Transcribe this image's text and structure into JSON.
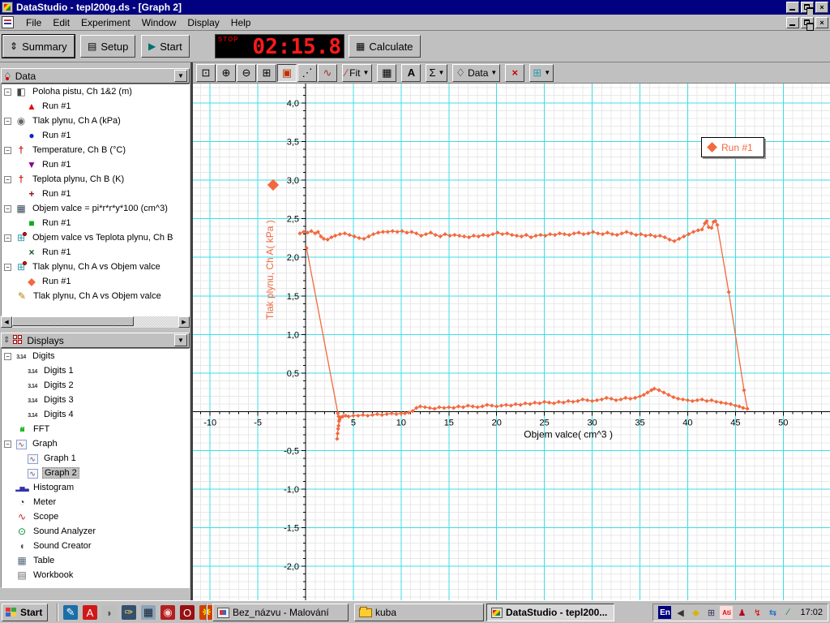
{
  "window": {
    "title": "DataStudio - tepl200g.ds - [Graph 2]"
  },
  "menu": {
    "items": [
      "File",
      "Edit",
      "Experiment",
      "Window",
      "Display",
      "Help"
    ]
  },
  "toolbar": {
    "summary_label": "Summary",
    "setup_label": "Setup",
    "start_label": "Start",
    "timer_stop_label": "STOP",
    "timer_value": "02:15.8",
    "calculate_label": "Calculate"
  },
  "graph_toolbar": {
    "buttons": [
      {
        "name": "scale-to-fit-button",
        "glyph": "⊡"
      },
      {
        "name": "zoom-in-button",
        "glyph": "⊕"
      },
      {
        "name": "zoom-out-button",
        "glyph": "⊖"
      },
      {
        "name": "zoom-select-button",
        "glyph": "⊞"
      },
      {
        "name": "smart-tool-button",
        "glyph": "▣",
        "pressed": true,
        "color": "#c03000"
      },
      {
        "name": "slope-tool-button",
        "glyph": "⋰"
      },
      {
        "name": "curve-note-button",
        "glyph": "∿",
        "color": "#a03030"
      },
      {
        "name": "fit-dropdown",
        "glyph": "∕",
        "label": "Fit",
        "dropdown": true,
        "color": "#c03030",
        "sep": true
      },
      {
        "name": "calculator-button",
        "glyph": "▦",
        "sep": true
      },
      {
        "name": "text-annotation-button",
        "glyph": "A",
        "bold": true,
        "sep": true
      },
      {
        "name": "statistics-dropdown",
        "glyph": "Σ",
        "dropdown": true,
        "sep": true
      },
      {
        "name": "data-dropdown",
        "glyph": "♢",
        "label": "Data",
        "dropdown": true,
        "sep": true,
        "reddot": true
      },
      {
        "name": "delete-button",
        "glyph": "×",
        "bold": true,
        "color": "#cc0000",
        "sep": true
      },
      {
        "name": "graph-settings-dropdown",
        "glyph": "⊞",
        "dropdown": true,
        "color": "#2d99a8",
        "sep": true
      }
    ]
  },
  "sidebar": {
    "data_panel": {
      "title": "Data",
      "items": [
        {
          "label": "Poloha pistu, Ch 1&2 (m)",
          "icon": "motion-sensor",
          "expanded": true,
          "runs": [
            {
              "label": "Run #1",
              "marker": "▲",
              "color": "#dd1111"
            }
          ]
        },
        {
          "label": "Tlak plynu, Ch A (kPa)",
          "icon": "pressure-sensor",
          "expanded": true,
          "runs": [
            {
              "label": "Run #1",
              "marker": "●",
              "color": "#1122cc"
            }
          ]
        },
        {
          "label": "Temperature, Ch B (°C)",
          "icon": "thermometer",
          "expanded": true,
          "runs": [
            {
              "label": "Run #1",
              "marker": "▼",
              "color": "#880099"
            }
          ]
        },
        {
          "label": "Teplota plynu, Ch B (K)",
          "icon": "thermometer",
          "expanded": true,
          "runs": [
            {
              "label": "Run #1",
              "marker": "+",
              "color": "#881111"
            }
          ]
        },
        {
          "label": "Objem valce = pi*r*r*y*100 (cm^3)",
          "icon": "calculator",
          "expanded": true,
          "runs": [
            {
              "label": "Run #1",
              "marker": "■",
              "color": "#11aa22"
            }
          ]
        },
        {
          "label": "Objem valce vs Teplota plynu, Ch B",
          "icon": "xy-data",
          "expanded": true,
          "runs": [
            {
              "label": "Run #1",
              "marker": "×",
              "color": "#115522"
            }
          ]
        },
        {
          "label": "Tlak plynu, Ch A vs Objem valce",
          "icon": "xy-data",
          "expanded": true,
          "runs": [
            {
              "label": "Run #1",
              "marker": "◆",
              "color": "#f2693f"
            }
          ]
        },
        {
          "label": "Tlak plynu, Ch A vs Objem valce",
          "icon": "pencil",
          "runs": []
        }
      ]
    },
    "displays_panel": {
      "title": "Displays",
      "items": [
        {
          "label": "Digits",
          "icon": "digits",
          "expanded": true,
          "children": [
            "Digits 1",
            "Digits 2",
            "Digits 3",
            "Digits 4"
          ]
        },
        {
          "label": "FFT",
          "icon": "fft"
        },
        {
          "label": "Graph",
          "icon": "graph",
          "expanded": true,
          "children": [
            "Graph 1",
            "Graph 2"
          ],
          "selected_child": "Graph 2"
        },
        {
          "label": "Histogram",
          "icon": "histogram"
        },
        {
          "label": "Meter",
          "icon": "meter"
        },
        {
          "label": "Scope",
          "icon": "scope"
        },
        {
          "label": "Sound Analyzer",
          "icon": "sound-analyzer"
        },
        {
          "label": "Sound Creator",
          "icon": "sound-creator"
        },
        {
          "label": "Table",
          "icon": "table"
        },
        {
          "label": "Workbook",
          "icon": "workbook"
        }
      ]
    }
  },
  "chart_data": {
    "type": "scatter",
    "xlabel": "Objem valce( cm^3 )",
    "ylabel": "Tlak plynu, Ch A( kPa )",
    "legend": "Run #1",
    "series_color": "#f2693f",
    "grid_major_color": "#3cdde4",
    "grid_minor_color": "#e8e8e8",
    "x_axis": {
      "min": -11.8,
      "max": 54.9,
      "major": 5,
      "minor": 1,
      "tick_labels": [
        -10,
        -5,
        5,
        10,
        15,
        20,
        25,
        30,
        35,
        40,
        45,
        50
      ]
    },
    "y_axis": {
      "min": -2.44,
      "max": 4.25,
      "major": 0.5,
      "minor": 0.1,
      "tick_labels": [
        {
          "v": 4.0,
          "label": "4,0"
        },
        {
          "v": 3.5,
          "label": "3,5"
        },
        {
          "v": 3.0,
          "label": "3,0"
        },
        {
          "v": 2.5,
          "label": "2,5"
        },
        {
          "v": 2.0,
          "label": "2,0"
        },
        {
          "v": 1.5,
          "label": "1,5"
        },
        {
          "v": 1.0,
          "label": "1,0"
        },
        {
          "v": 0.5,
          "label": "0,5"
        },
        {
          "v": -0.5,
          "label": "-0,5"
        },
        {
          "v": -1.0,
          "label": "-1,0"
        },
        {
          "v": -1.5,
          "label": "-1,5"
        },
        {
          "v": -2.0,
          "label": "-2,0"
        }
      ]
    },
    "points": [
      [
        -0.6,
        2.31
      ],
      [
        -0.2,
        2.33
      ],
      [
        0.2,
        2.32
      ],
      [
        0.6,
        2.34
      ],
      [
        1.0,
        2.31
      ],
      [
        1.3,
        2.33
      ],
      [
        1.6,
        2.27
      ],
      [
        1.9,
        2.24
      ],
      [
        2.3,
        2.23
      ],
      [
        2.7,
        2.26
      ],
      [
        3.1,
        2.28
      ],
      [
        3.6,
        2.3
      ],
      [
        4.1,
        2.31
      ],
      [
        4.6,
        2.29
      ],
      [
        5.1,
        2.27
      ],
      [
        5.6,
        2.25
      ],
      [
        6.1,
        2.24
      ],
      [
        6.6,
        2.27
      ],
      [
        7.1,
        2.3
      ],
      [
        7.6,
        2.32
      ],
      [
        8.1,
        2.33
      ],
      [
        8.6,
        2.33
      ],
      [
        9.1,
        2.34
      ],
      [
        9.6,
        2.33
      ],
      [
        10.1,
        2.34
      ],
      [
        10.6,
        2.32
      ],
      [
        11.1,
        2.33
      ],
      [
        11.6,
        2.31
      ],
      [
        12.1,
        2.28
      ],
      [
        12.6,
        2.3
      ],
      [
        13.1,
        2.32
      ],
      [
        13.6,
        2.29
      ],
      [
        14.1,
        2.27
      ],
      [
        14.6,
        2.3
      ],
      [
        15.1,
        2.28
      ],
      [
        15.6,
        2.29
      ],
      [
        16.1,
        2.28
      ],
      [
        16.6,
        2.27
      ],
      [
        17.1,
        2.26
      ],
      [
        17.6,
        2.28
      ],
      [
        18.1,
        2.27
      ],
      [
        18.6,
        2.29
      ],
      [
        19.1,
        2.28
      ],
      [
        19.6,
        2.3
      ],
      [
        20.1,
        2.32
      ],
      [
        20.6,
        2.3
      ],
      [
        21.1,
        2.31
      ],
      [
        21.6,
        2.29
      ],
      [
        22.1,
        2.28
      ],
      [
        22.6,
        2.27
      ],
      [
        23.1,
        2.29
      ],
      [
        23.6,
        2.26
      ],
      [
        24.1,
        2.28
      ],
      [
        24.6,
        2.29
      ],
      [
        25.1,
        2.28
      ],
      [
        25.6,
        2.3
      ],
      [
        26.1,
        2.29
      ],
      [
        26.6,
        2.31
      ],
      [
        27.1,
        2.3
      ],
      [
        27.6,
        2.29
      ],
      [
        28.1,
        2.31
      ],
      [
        28.6,
        2.32
      ],
      [
        29.1,
        2.3
      ],
      [
        29.6,
        2.31
      ],
      [
        30.1,
        2.33
      ],
      [
        30.6,
        2.31
      ],
      [
        31.1,
        2.3
      ],
      [
        31.6,
        2.32
      ],
      [
        32.1,
        2.3
      ],
      [
        32.6,
        2.29
      ],
      [
        33.1,
        2.31
      ],
      [
        33.6,
        2.33
      ],
      [
        34.1,
        2.31
      ],
      [
        34.6,
        2.29
      ],
      [
        35.1,
        2.3
      ],
      [
        35.6,
        2.28
      ],
      [
        36.1,
        2.29
      ],
      [
        36.6,
        2.27
      ],
      [
        37.1,
        2.28
      ],
      [
        37.6,
        2.26
      ],
      [
        38.1,
        2.23
      ],
      [
        38.6,
        2.21
      ],
      [
        39.1,
        2.24
      ],
      [
        39.6,
        2.27
      ],
      [
        40.1,
        2.3
      ],
      [
        40.6,
        2.33
      ],
      [
        41.1,
        2.35
      ],
      [
        41.5,
        2.36
      ],
      [
        41.8,
        2.44
      ],
      [
        42.0,
        2.47
      ],
      [
        42.2,
        2.39
      ],
      [
        42.5,
        2.38
      ],
      [
        42.7,
        2.46
      ],
      [
        42.9,
        2.47
      ],
      [
        43.1,
        2.42
      ],
      [
        44.3,
        1.55
      ],
      [
        45.9,
        0.28
      ],
      [
        46.25,
        0.04
      ],
      [
        45.8,
        0.05
      ],
      [
        45.4,
        0.07
      ],
      [
        45.0,
        0.08
      ],
      [
        44.5,
        0.1
      ],
      [
        44.0,
        0.11
      ],
      [
        43.5,
        0.12
      ],
      [
        43.0,
        0.13
      ],
      [
        42.5,
        0.15
      ],
      [
        42.0,
        0.14
      ],
      [
        41.5,
        0.16
      ],
      [
        41.0,
        0.15
      ],
      [
        40.5,
        0.14
      ],
      [
        40.0,
        0.15
      ],
      [
        39.5,
        0.16
      ],
      [
        39.0,
        0.17
      ],
      [
        38.5,
        0.19
      ],
      [
        38.0,
        0.22
      ],
      [
        37.5,
        0.25
      ],
      [
        37.0,
        0.28
      ],
      [
        36.5,
        0.3
      ],
      [
        36.2,
        0.28
      ],
      [
        35.8,
        0.25
      ],
      [
        35.4,
        0.22
      ],
      [
        35.0,
        0.2
      ],
      [
        34.5,
        0.18
      ],
      [
        34.0,
        0.17
      ],
      [
        33.5,
        0.18
      ],
      [
        33.0,
        0.16
      ],
      [
        32.5,
        0.15
      ],
      [
        32.0,
        0.17
      ],
      [
        31.5,
        0.18
      ],
      [
        31.0,
        0.16
      ],
      [
        30.5,
        0.15
      ],
      [
        30.0,
        0.14
      ],
      [
        29.5,
        0.15
      ],
      [
        29.0,
        0.16
      ],
      [
        28.5,
        0.14
      ],
      [
        28.0,
        0.13
      ],
      [
        27.5,
        0.14
      ],
      [
        27.0,
        0.12
      ],
      [
        26.5,
        0.13
      ],
      [
        26.0,
        0.11
      ],
      [
        25.5,
        0.12
      ],
      [
        25.0,
        0.13
      ],
      [
        24.5,
        0.11
      ],
      [
        24.0,
        0.12
      ],
      [
        23.5,
        0.1
      ],
      [
        23.0,
        0.11
      ],
      [
        22.5,
        0.09
      ],
      [
        22.0,
        0.1
      ],
      [
        21.5,
        0.08
      ],
      [
        21.0,
        0.09
      ],
      [
        20.5,
        0.08
      ],
      [
        20.0,
        0.07
      ],
      [
        19.5,
        0.08
      ],
      [
        19.0,
        0.09
      ],
      [
        18.5,
        0.07
      ],
      [
        18.0,
        0.06
      ],
      [
        17.5,
        0.07
      ],
      [
        17.0,
        0.08
      ],
      [
        16.5,
        0.06
      ],
      [
        16.0,
        0.07
      ],
      [
        15.5,
        0.05
      ],
      [
        15.0,
        0.06
      ],
      [
        14.5,
        0.05
      ],
      [
        14.0,
        0.06
      ],
      [
        13.5,
        0.04
      ],
      [
        13.0,
        0.05
      ],
      [
        12.5,
        0.06
      ],
      [
        12.0,
        0.07
      ],
      [
        11.6,
        0.05
      ],
      [
        11.2,
        0.01
      ],
      [
        10.8,
        -0.01
      ],
      [
        10.4,
        -0.02
      ],
      [
        10.0,
        -0.02
      ],
      [
        9.5,
        -0.03
      ],
      [
        9.0,
        -0.02
      ],
      [
        8.5,
        -0.03
      ],
      [
        8.0,
        -0.04
      ],
      [
        7.5,
        -0.03
      ],
      [
        7.0,
        -0.04
      ],
      [
        6.5,
        -0.05
      ],
      [
        6.0,
        -0.04
      ],
      [
        5.5,
        -0.05
      ],
      [
        5.0,
        -0.05
      ],
      [
        4.5,
        -0.06
      ],
      [
        4.2,
        -0.05
      ],
      [
        3.9,
        -0.06
      ],
      [
        3.7,
        -0.07
      ],
      [
        3.55,
        -0.1
      ],
      [
        3.45,
        -0.18
      ],
      [
        3.35,
        -0.28
      ],
      [
        3.3,
        -0.35
      ],
      [
        3.4,
        -0.22
      ],
      [
        3.5,
        -0.12
      ],
      [
        3.45,
        -0.06
      ],
      [
        3.38,
        -0.02
      ],
      [
        0.1,
        2.12
      ]
    ]
  },
  "taskbar": {
    "start_label": "Start",
    "quicklaunch": [
      {
        "name": "quicklaunch-notes-icon",
        "glyph": "✎",
        "color": "#1b6ea8",
        "fg": "#fff"
      },
      {
        "name": "quicklaunch-acrobat-icon",
        "glyph": "A",
        "color": "#d01818",
        "fg": "#fff"
      },
      {
        "name": "quicklaunch-bird-icon",
        "glyph": "◗",
        "color": "#bdbdbd",
        "fg": "#555"
      },
      {
        "name": "quicklaunch-pen-icon",
        "glyph": "✑",
        "color": "#35506e",
        "fg": "#fd5"
      },
      {
        "name": "quicklaunch-calculator-icon",
        "glyph": "▦",
        "color": "#8fa3b8",
        "fg": "#123"
      },
      {
        "name": "quicklaunch-dragon-icon",
        "glyph": "◉",
        "color": "#b02020",
        "fg": "#fcc"
      },
      {
        "name": "quicklaunch-opera-icon",
        "glyph": "O",
        "color": "#981010",
        "fg": "#fff"
      },
      {
        "name": "quicklaunch-flame-icon",
        "glyph": "❋",
        "color": "#d04000",
        "fg": "#ff0"
      }
    ],
    "tasks": [
      {
        "label": "Bez_názvu - Malování",
        "icon": "paint",
        "active": false
      },
      {
        "label": "kuba",
        "icon": "folder",
        "active": false
      },
      {
        "label": "DataStudio - tepl200...",
        "icon": "datastudio",
        "active": true
      }
    ],
    "tray": {
      "lang": "En",
      "icons": [
        {
          "name": "tray-volume-icon",
          "glyph": "◀",
          "color": "#333"
        },
        {
          "name": "tray-diamond-icon",
          "glyph": "◆",
          "color": "#d8b400"
        },
        {
          "name": "tray-scheduler-icon",
          "glyph": "⊞",
          "color": "#336"
        },
        {
          "name": "tray-ati-icon",
          "glyph": "Ati",
          "color": "#cc1111",
          "badge": true
        },
        {
          "name": "tray-agent-icon",
          "glyph": "♟",
          "color": "#b02"
        },
        {
          "name": "tray-power-icon",
          "glyph": "↯",
          "color": "#d00"
        },
        {
          "name": "tray-sync-icon",
          "glyph": "⇆",
          "color": "#06c"
        },
        {
          "name": "tray-pen-icon",
          "glyph": "∕",
          "color": "#083"
        }
      ],
      "time": "17:02"
    }
  }
}
